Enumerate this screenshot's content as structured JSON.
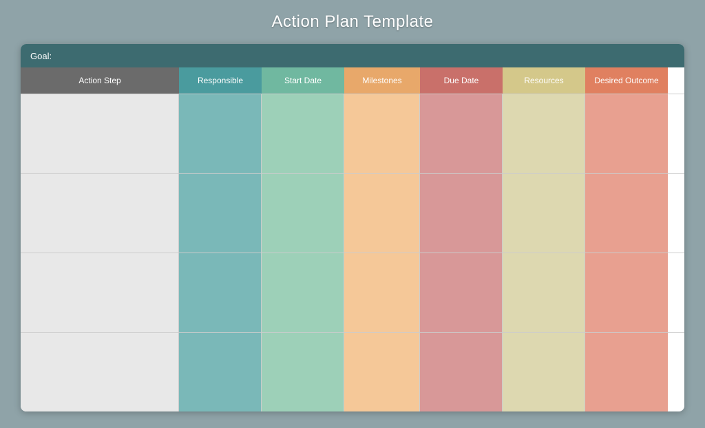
{
  "page": {
    "title": "Action Plan Template",
    "background": "#8fa3a8"
  },
  "table": {
    "goal_label": "Goal:",
    "headers": [
      {
        "id": "action-step",
        "label": "Action Step",
        "class": "hc-action-step"
      },
      {
        "id": "responsible",
        "label": "Responsible",
        "class": "hc-responsible"
      },
      {
        "id": "start-date",
        "label": "Start Date",
        "class": "hc-start-date"
      },
      {
        "id": "milestones",
        "label": "Milestones",
        "class": "hc-milestones"
      },
      {
        "id": "due-date",
        "label": "Due Date",
        "class": "hc-due-date"
      },
      {
        "id": "resources",
        "label": "Resources",
        "class": "hc-resources"
      },
      {
        "id": "desired-outcome",
        "label": "Desired Outcome",
        "class": "hc-desired-outcome"
      }
    ],
    "rows": [
      {
        "id": "row-1"
      },
      {
        "id": "row-2"
      },
      {
        "id": "row-3"
      },
      {
        "id": "row-4"
      }
    ]
  }
}
